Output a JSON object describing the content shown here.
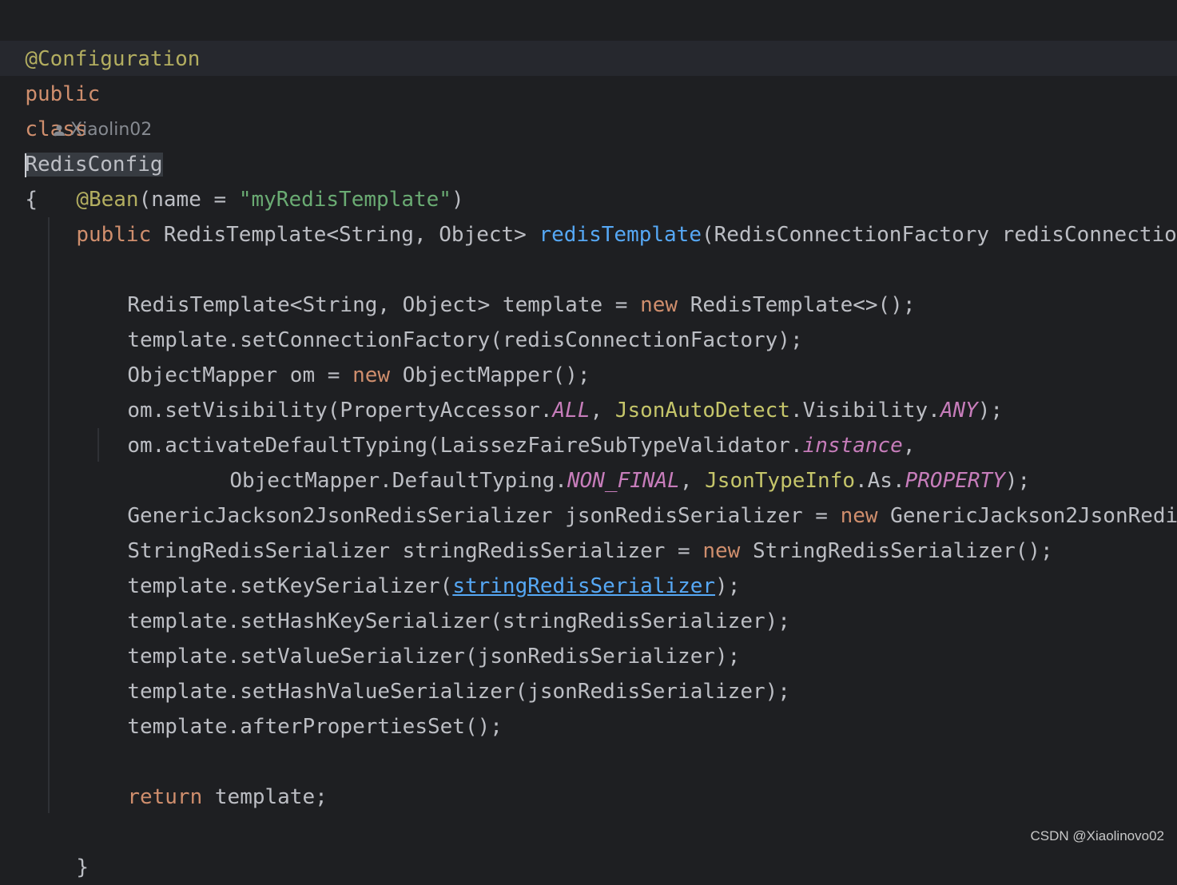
{
  "editor": {
    "annotation_config": "@Configuration",
    "class_line": {
      "kw1": "public",
      "kw2": "class",
      "name": "RedisConfig",
      "brace": "{"
    },
    "author": "Xiaolin02",
    "bean": {
      "ann": "@Bean",
      "args_pre": "(name = ",
      "arg_str": "\"myRedisTemplate\"",
      "args_post": ")"
    },
    "method_sig": {
      "kw": "public",
      "type": "RedisTemplate<String, Object> ",
      "name": "redisTemplate",
      "params": "(RedisConnectionFactory redisConnectio"
    },
    "body": {
      "l1": {
        "a": "RedisTemplate<String, Object> template = ",
        "kw": "new",
        "b": " RedisTemplate<>();"
      },
      "l2": "template.setConnectionFactory(redisConnectionFactory);",
      "l3": {
        "a": "ObjectMapper om = ",
        "kw": "new",
        "b": " ObjectMapper();"
      },
      "l4": {
        "a": "om.setVisibility(PropertyAccessor.",
        "s1": "ALL",
        "b": ", ",
        "c1": "JsonAutoDetect",
        "c": ".Visibility.",
        "s2": "ANY",
        "d": ");"
      },
      "l5": {
        "a": "om.activateDefaultTyping(LaissezFaireSubTypeValidator.",
        "s1": "instance",
        "b": ","
      },
      "l6": {
        "a": "ObjectMapper.DefaultTyping.",
        "s1": "NON_FINAL",
        "b": ", ",
        "c1": "JsonTypeInfo",
        "c": ".As.",
        "s2": "PROPERTY",
        "d": ");"
      },
      "l7": {
        "a": "GenericJackson2JsonRedisSerializer jsonRedisSerializer = ",
        "kw": "new",
        "b": " GenericJackson2JsonRedi"
      },
      "l8": {
        "a": "StringRedisSerializer stringRedisSerializer = ",
        "kw": "new",
        "b": " StringRedisSerializer();"
      },
      "l9": {
        "a": "template.setKeySerializer(",
        "link": "stringRedisSerializer",
        "b": ");"
      },
      "l10": "template.setHashKeySerializer(stringRedisSerializer);",
      "l11": "template.setValueSerializer(jsonRedisSerializer);",
      "l12": "template.setHashValueSerializer(jsonRedisSerializer);",
      "l13": "template.afterPropertiesSet();",
      "ret": {
        "kw": "return",
        "b": " template;"
      },
      "close": "}"
    }
  },
  "watermark": "CSDN @Xiaolinovo02",
  "colors": {
    "background": "#1e1f22",
    "keyword": "#cf8e6d",
    "annotation": "#b3ae60",
    "string": "#6aab73",
    "method": "#56a8f5",
    "static_field": "#c77dbb"
  }
}
